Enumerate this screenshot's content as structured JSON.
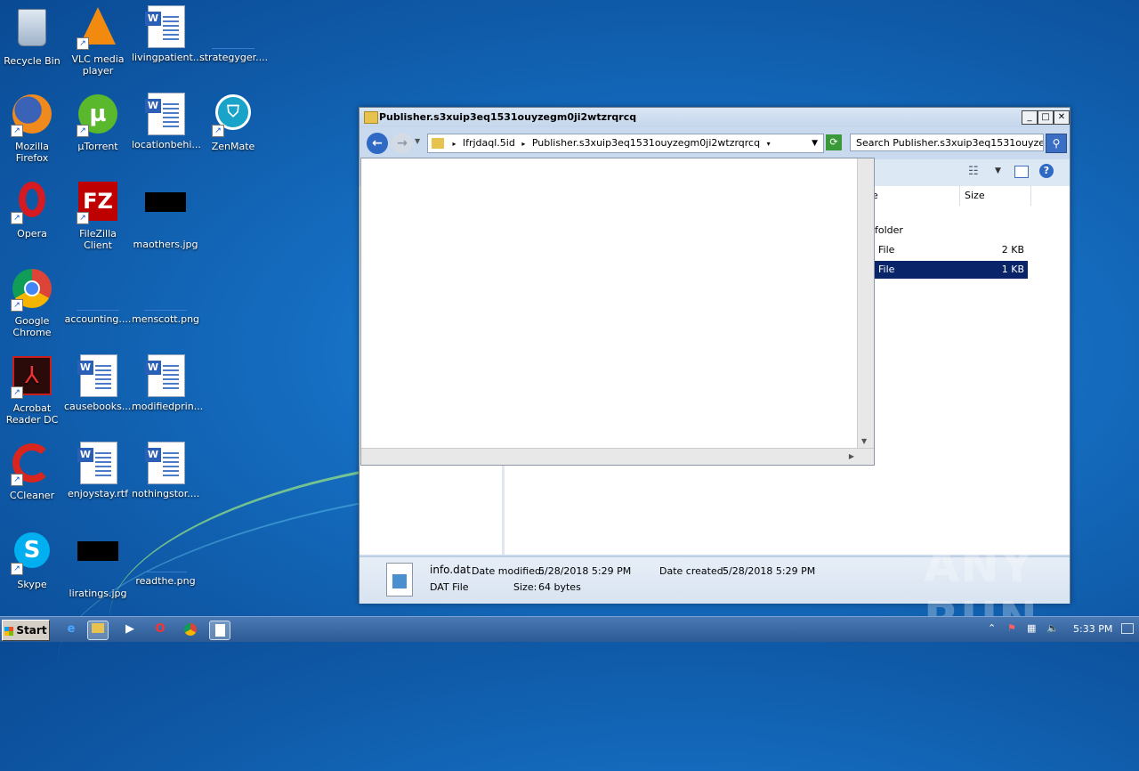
{
  "desktop": {
    "icons": [
      {
        "label": "Recycle Bin",
        "icon": "recycle-bin-icon"
      },
      {
        "label": "VLC media player",
        "icon": "vlc-icon"
      },
      {
        "label": "livingpatient....",
        "icon": "word-doc-icon"
      },
      {
        "label": "strategyger....",
        "icon": "blank-file-icon"
      },
      {
        "label": "Mozilla Firefox",
        "icon": "firefox-icon"
      },
      {
        "label": "µTorrent",
        "icon": "utorrent-icon"
      },
      {
        "label": "locationbehi...",
        "icon": "word-doc-icon"
      },
      {
        "label": "ZenMate",
        "icon": "zenmate-icon"
      },
      {
        "label": "Opera",
        "icon": "opera-icon"
      },
      {
        "label": "FileZilla Client",
        "icon": "filezilla-icon"
      },
      {
        "label": "maothers.jpg",
        "icon": "image-file-icon"
      },
      {
        "label": "Google Chrome",
        "icon": "chrome-icon"
      },
      {
        "label": "accounting....",
        "icon": "blank-file-icon"
      },
      {
        "label": "menscott.png",
        "icon": "blank-file-icon"
      },
      {
        "label": "Acrobat Reader DC",
        "icon": "acrobat-icon"
      },
      {
        "label": "causebooks....",
        "icon": "word-doc-icon"
      },
      {
        "label": "modifiedprin...",
        "icon": "word-doc-icon"
      },
      {
        "label": "CCleaner",
        "icon": "ccleaner-icon"
      },
      {
        "label": "enjoystay.rtf",
        "icon": "word-doc-icon"
      },
      {
        "label": "nothingstor....",
        "icon": "word-doc-icon"
      },
      {
        "label": "Skype",
        "icon": "skype-icon"
      },
      {
        "label": "liratings.jpg",
        "icon": "image-file-icon"
      },
      {
        "label": "readthe.png",
        "icon": "blank-file-icon"
      }
    ]
  },
  "explorer": {
    "title": "Publisher.s3xuip3eq1531ouyzegm0ji2wtzrqrcq",
    "breadcrumb": [
      "lfrjdaql.5id",
      "Publisher.s3xuip3eq1531ouyzegm0ji2wtzrqrcq"
    ],
    "search_placeholder": "Search Publisher.s3xuip3eq1531ouyze...",
    "columns": {
      "name_partial": "e",
      "size": "Size"
    },
    "rows": [
      {
        "type": "folder",
        "size": ""
      },
      {
        "type": "File",
        "size": "2 KB"
      },
      {
        "type": "File",
        "size": "1 KB",
        "selected": true
      }
    ],
    "details": {
      "filename": "info.dat",
      "filetype": "DAT File",
      "date_modified_label": "Date modified:",
      "date_modified": "5/28/2018 5:29 PM",
      "size_label": "Size:",
      "size": "64 bytes",
      "date_created_label": "Date created:",
      "date_created": "5/28/2018 5:29 PM"
    }
  },
  "taskbar": {
    "start_label": "Start",
    "clock": "5:33 PM"
  },
  "watermark": "ANY RUN"
}
